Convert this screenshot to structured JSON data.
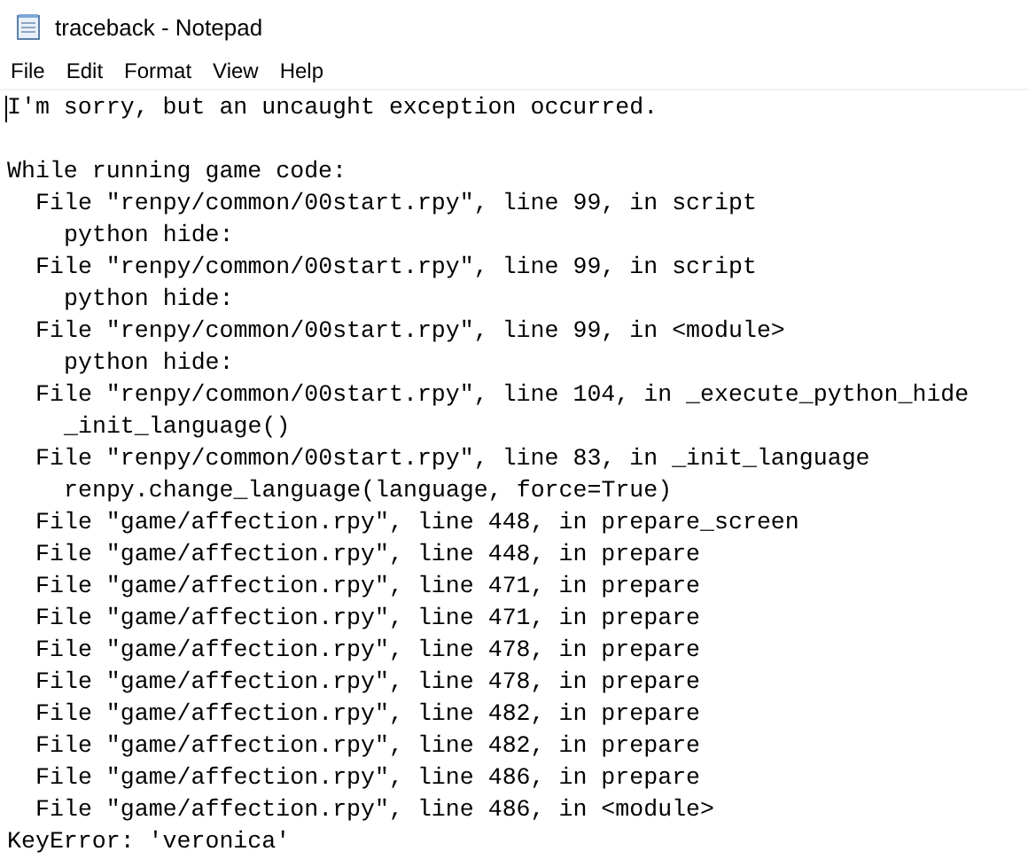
{
  "window": {
    "title": "traceback - Notepad"
  },
  "menu": [
    "File",
    "Edit",
    "Format",
    "View",
    "Help"
  ],
  "document": {
    "message": "I'm sorry, but an uncaught exception occurred.",
    "traceback": {
      "heading": "While running game code:",
      "frames": [
        {
          "text": "File \"renpy/common/00start.rpy\", line 99, in script",
          "children": [
            {
              "text": "python hide:"
            }
          ]
        },
        {
          "text": "File \"renpy/common/00start.rpy\", line 99, in script",
          "children": [
            {
              "text": "python hide:"
            }
          ]
        },
        {
          "text": "File \"renpy/common/00start.rpy\", line 99, in <module>",
          "children": [
            {
              "text": "python hide:"
            }
          ]
        },
        {
          "text": "File \"renpy/common/00start.rpy\", line 104, in _execute_python_hide",
          "children": [
            {
              "text": "_init_language()"
            }
          ]
        },
        {
          "text": "File \"renpy/common/00start.rpy\", line 83, in _init_language",
          "children": [
            {
              "text": "renpy.change_language(language, force=True)"
            }
          ]
        },
        {
          "text": "File \"game/affection.rpy\", line 448, in prepare_screen"
        },
        {
          "text": "File \"game/affection.rpy\", line 448, in prepare"
        },
        {
          "text": "File \"game/affection.rpy\", line 471, in prepare"
        },
        {
          "text": "File \"game/affection.rpy\", line 471, in prepare"
        },
        {
          "text": "File \"game/affection.rpy\", line 478, in prepare"
        },
        {
          "text": "File \"game/affection.rpy\", line 478, in prepare"
        },
        {
          "text": "File \"game/affection.rpy\", line 482, in prepare"
        },
        {
          "text": "File \"game/affection.rpy\", line 482, in prepare"
        },
        {
          "text": "File \"game/affection.rpy\", line 486, in prepare"
        },
        {
          "text": "File \"game/affection.rpy\", line 486, in <module>"
        }
      ]
    },
    "error": "KeyError: 'veronica'"
  }
}
